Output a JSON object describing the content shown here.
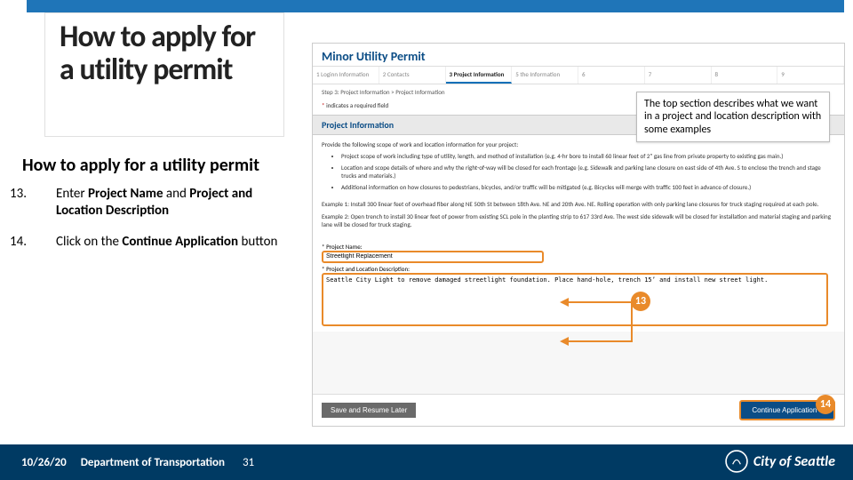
{
  "slide": {
    "title": "How to apply for a utility permit",
    "subtitle": "How to apply for a utility permit",
    "steps": {
      "s13": {
        "num": "13.",
        "text_a": "Enter ",
        "b1": "Project Name",
        "text_b": " and ",
        "b2": "Project and Location Description"
      },
      "s14": {
        "num": "14.",
        "text_a": "Click on the ",
        "b1": "Continue Application",
        "text_b": " button"
      }
    }
  },
  "callouts": {
    "top": "The top section describes what we want in a project and location description with some examples",
    "badge13": "13",
    "badge14": "14"
  },
  "form": {
    "app_title": "Minor Utility Permit",
    "wizard": [
      "1  Loginn Information",
      "2  Contacts",
      "3  Project Information",
      "5  the Information",
      "6",
      "7",
      "8",
      "9"
    ],
    "active_step_index": 2,
    "breadcrumb": "Step 3: Project Information > Project Information",
    "required_note": "* indicates a required field",
    "section_header": "Project Information",
    "intro": "Provide the following scope of work and location information for your project:",
    "bullets": [
      "Project scope of work including type of utility, length, and method of installation (e.g. 4-hr bore to install 60 linear feet of 2\" gas line from private property to existing gas main.)",
      "Location and scope details of where and why the right-of-way will be closed for each frontage (e.g. Sidewalk and parking lane closure on east side of 4th Ave. S to enclose the trench and stage trucks and materials.)",
      "Additional information on how closures to pedestrians, bicycles, and/or traffic will be mitigated (e.g. Bicycles will merge with traffic 100 feet in advance of closure.)"
    ],
    "example1": "Example 1: Install 300 linear feet of overhead fiber along NE 50th St between 18th Ave. NE and 20th Ave. NE. Rolling operation with only parking lane closures for truck staging required at each pole.",
    "example2": "Example 2: Open trench to install 30 linear feet of power from existing SCL pole in the planting strip to 617 33rd Ave. The west side sidewalk will be closed for installation and material staging and parking lane will be closed for truck staging.",
    "project_name_label": "* Project Name:",
    "project_name_value": "Streetlight Replacement",
    "desc_label": "* Project and Location Description:",
    "desc_value": "Seattle City Light to remove damaged streetlight foundation. Place hand-hole, trench 15’ and install new street light.",
    "save_btn": "Save and Resume Later",
    "continue_btn": "Continue Application »"
  },
  "footer": {
    "date": "10/26/20",
    "dept": "Department of Transportation",
    "page": "31",
    "city": "City of Seattle"
  }
}
